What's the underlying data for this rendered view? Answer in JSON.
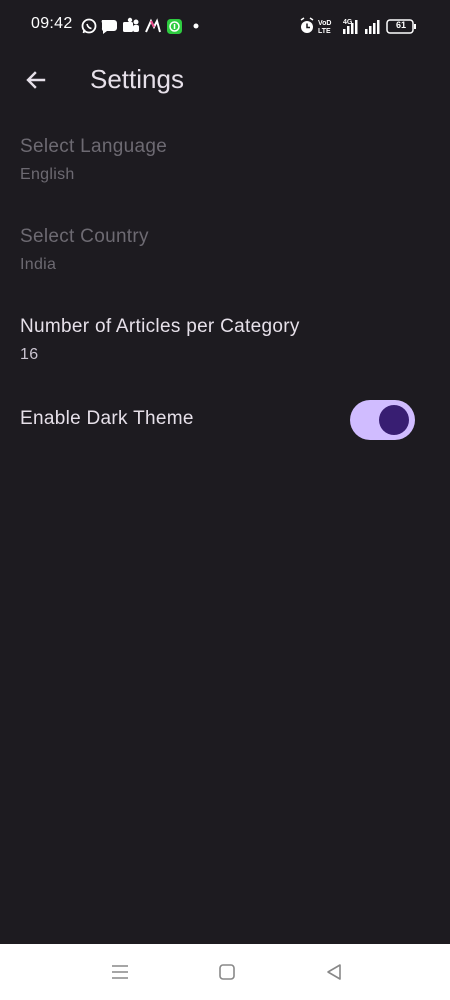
{
  "status_bar": {
    "time": "09:42",
    "battery": "61",
    "left_icons": [
      "whatsapp-icon",
      "chat-icon",
      "teams-icon",
      "app-icon",
      "green-app-icon",
      "dot-icon"
    ],
    "right_icons": [
      "alarm-icon",
      "volte-icon",
      "signal-4g-icon",
      "signal-icon",
      "battery-icon"
    ]
  },
  "app_bar": {
    "title": "Settings",
    "back_icon": "arrow-back-icon"
  },
  "settings": {
    "language": {
      "title": "Select Language",
      "value": "English"
    },
    "country": {
      "title": "Select Country",
      "value": "India"
    },
    "articles": {
      "title": "Number of Articles per Category",
      "value": "16"
    },
    "dark_theme": {
      "title": "Enable Dark Theme",
      "enabled": true
    }
  },
  "colors": {
    "background": "#1d1b20",
    "toggle_track": "#d0bcff",
    "toggle_knob": "#381e72",
    "disabled_text": "#6d6a72",
    "primary_text": "#e6e0e9"
  },
  "nav_bar": {
    "buttons": [
      "menu-icon",
      "home-square-icon",
      "back-triangle-icon"
    ]
  }
}
